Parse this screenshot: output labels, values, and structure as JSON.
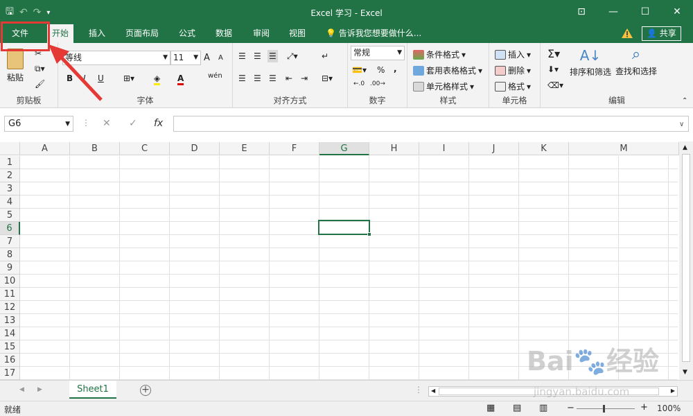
{
  "window": {
    "title": "Excel 学习 - Excel"
  },
  "tabs": [
    {
      "label": "文件"
    },
    {
      "label": "开始"
    },
    {
      "label": "插入"
    },
    {
      "label": "页面布局"
    },
    {
      "label": "公式"
    },
    {
      "label": "数据"
    },
    {
      "label": "审阅"
    },
    {
      "label": "视图"
    }
  ],
  "tell_me": "告诉我您想要做什么...",
  "share_label": "共享",
  "ribbon": {
    "clipboard": {
      "paste": "粘贴",
      "label": "剪贴板"
    },
    "font": {
      "name": "等线",
      "size": "11",
      "label": "字体",
      "bold": "B",
      "italic": "I",
      "underline": "U",
      "grow": "A",
      "shrink": "A",
      "color": "A",
      "wen": "wén"
    },
    "alignment": {
      "label": "对齐方式"
    },
    "number": {
      "format": "常规",
      "label": "数字",
      "percent": "%",
      "comma": ","
    },
    "styles": {
      "conditional": "条件格式",
      "table": "套用表格格式",
      "cell": "单元格样式",
      "label": "样式"
    },
    "cells": {
      "insert": "插入",
      "delete": "删除",
      "format": "格式",
      "label": "单元格"
    },
    "editing": {
      "sort": "排序和筛选",
      "find": "查找和选择",
      "label": "编辑"
    }
  },
  "formula_bar": {
    "name_box": "G6",
    "fx": "fx",
    "cancel": "✕",
    "enter": "✓",
    "value": ""
  },
  "columns": [
    "A",
    "B",
    "C",
    "D",
    "E",
    "F",
    "G",
    "H",
    "I",
    "J",
    "K",
    "M"
  ],
  "rows": [
    "1",
    "2",
    "3",
    "4",
    "5",
    "6",
    "7",
    "8",
    "9",
    "10",
    "11",
    "12",
    "13",
    "14",
    "15",
    "16",
    "17"
  ],
  "selected_cell": "G6",
  "sheets": [
    {
      "label": "Sheet1"
    }
  ],
  "add_sheet": "+",
  "status": {
    "text": "就绪",
    "zoom": "100%"
  },
  "watermark": {
    "main": "Bai🐾经验",
    "sub": "jingyan.baidu.com"
  },
  "colors": {
    "accent": "#217346",
    "highlight": "#e53935"
  }
}
